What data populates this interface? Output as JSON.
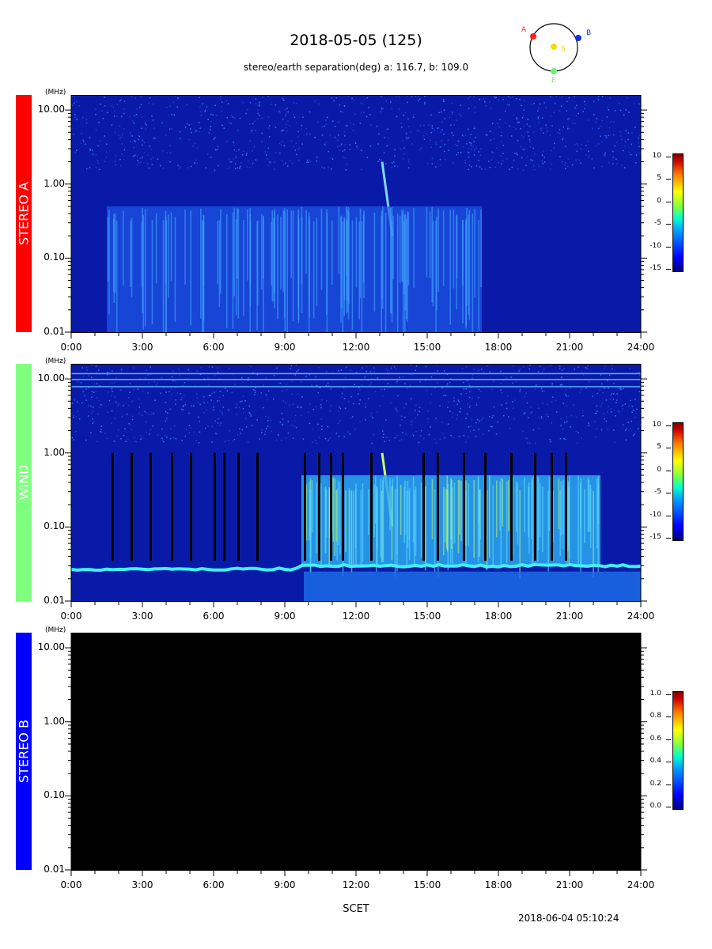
{
  "header": {
    "title": "2018-05-05 (125)",
    "subtitle": "stereo/earth separation(deg) a: 116.7, b: 109.0"
  },
  "orbit_diagram": {
    "labels": {
      "a": "A",
      "b": "B",
      "s": "S",
      "e": "E"
    },
    "colors": {
      "a": "#ff2020",
      "b": "#1030e0",
      "s": "#f0e000",
      "e": "#70f070"
    }
  },
  "footer": {
    "xlabel": "SCET",
    "timestamp": "2018-06-04 05:10:24"
  },
  "chart_data": [
    {
      "type": "heatmap",
      "name": "STEREO A",
      "label_color": "#ff0000",
      "unit": "(MHz)",
      "y_ticks": [
        "10.00",
        "1.00",
        "0.10",
        "0.01"
      ],
      "x_ticks": [
        "0:00",
        "3:00",
        "6:00",
        "9:00",
        "12:00",
        "15:00",
        "18:00",
        "21:00",
        "24:00"
      ],
      "x_range": [
        0,
        24
      ],
      "y_range_mhz": [
        0.01,
        16
      ],
      "y_scale": "log",
      "colorbar": {
        "ticks": [
          "10",
          "5",
          "0",
          "-5",
          "-10",
          "-15"
        ],
        "range": [
          -15,
          10
        ]
      },
      "features": [
        {
          "type": "burst",
          "time_hours": 13.2,
          "freq_mhz": [
            0.2,
            2.0
          ]
        },
        {
          "type": "band",
          "time_hours": [
            1.5,
            17.3
          ],
          "freq_mhz": [
            0.01,
            0.5
          ]
        }
      ]
    },
    {
      "type": "heatmap",
      "name": "WIND",
      "label_color": "#80ff80",
      "unit": "(MHz)",
      "y_ticks": [
        "10.00",
        "1.00",
        "0.10",
        "0.01"
      ],
      "x_ticks": [
        "0:00",
        "3:00",
        "6:00",
        "9:00",
        "12:00",
        "15:00",
        "18:00",
        "21:00",
        "24:00"
      ],
      "x_range": [
        0,
        24
      ],
      "y_range_mhz": [
        0.01,
        16
      ],
      "y_scale": "log",
      "colorbar": {
        "ticks": [
          "10",
          "5",
          "0",
          "-5",
          "-10",
          "-15"
        ],
        "range": [
          -15,
          10
        ]
      },
      "features": [
        {
          "type": "burst",
          "time_hours": 13.2,
          "freq_mhz": [
            0.1,
            1.0
          ]
        },
        {
          "type": "band",
          "time_hours": [
            9.7,
            22.3
          ],
          "freq_mhz": [
            0.03,
            0.5
          ]
        }
      ]
    },
    {
      "type": "heatmap",
      "name": "STEREO B",
      "label_color": "#0000ff",
      "unit": "(MHz)",
      "y_ticks": [
        "10.00",
        "1.00",
        "0.10",
        "0.01"
      ],
      "x_ticks": [
        "0:00",
        "3:00",
        "6:00",
        "9:00",
        "12:00",
        "15:00",
        "18:00",
        "21:00",
        "24:00"
      ],
      "x_range": [
        0,
        24
      ],
      "y_range_mhz": [
        0.01,
        16
      ],
      "y_scale": "log",
      "colorbar": {
        "ticks": [
          "1.0",
          "0.8",
          "0.6",
          "0.4",
          "0.2",
          "0.0"
        ],
        "range": [
          0,
          1
        ]
      },
      "features": []
    }
  ]
}
